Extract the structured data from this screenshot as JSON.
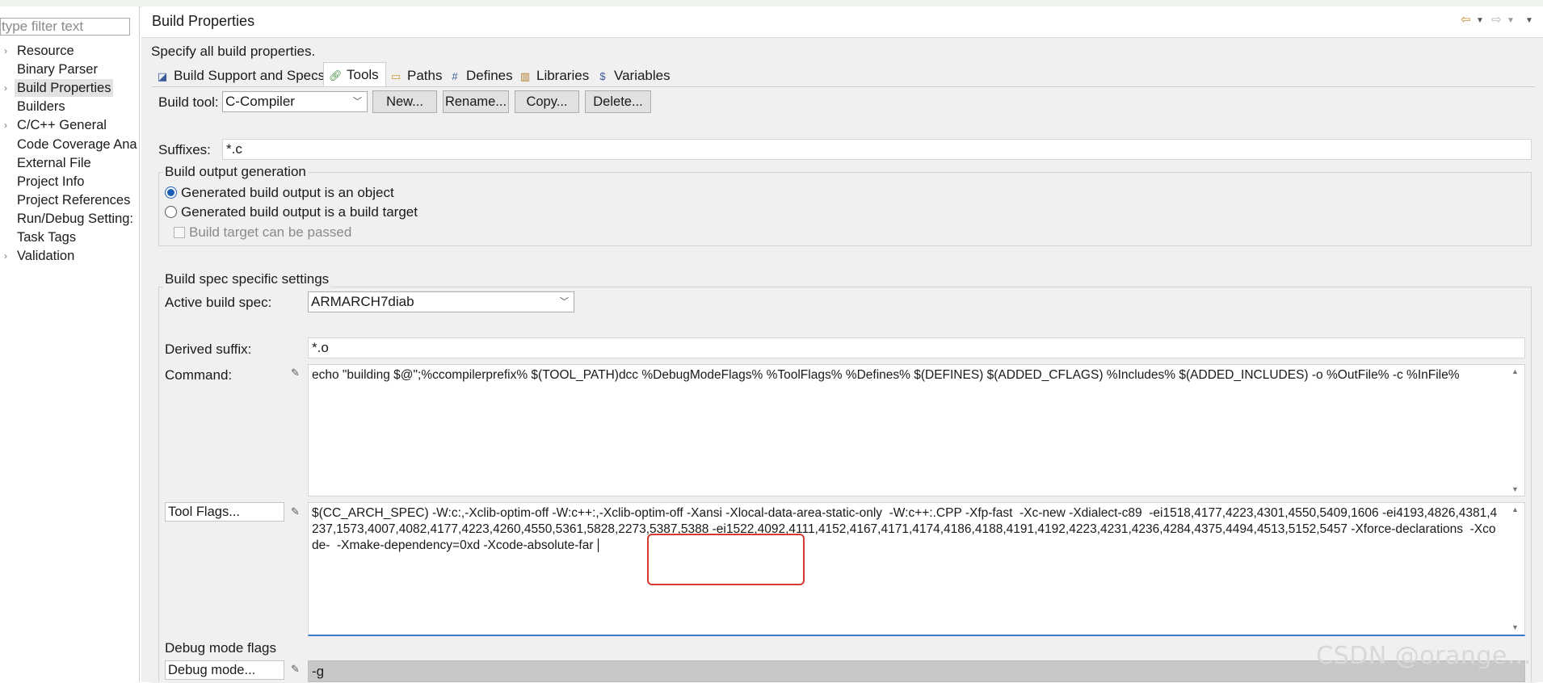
{
  "sidebar": {
    "filter_placeholder": "type filter text",
    "items": [
      {
        "label": "Resource",
        "expandable": true
      },
      {
        "label": "Binary Parser",
        "expandable": false
      },
      {
        "label": "Build Properties",
        "expandable": true,
        "selected": true
      },
      {
        "label": "Builders",
        "expandable": false
      },
      {
        "label": "C/C++ General",
        "expandable": true
      },
      {
        "label": "Code Coverage Ana",
        "expandable": false
      },
      {
        "label": "External File",
        "expandable": false
      },
      {
        "label": "Project Info",
        "expandable": false
      },
      {
        "label": "Project References",
        "expandable": false
      },
      {
        "label": "Run/Debug Setting:",
        "expandable": false
      },
      {
        "label": "Task Tags",
        "expandable": false
      },
      {
        "label": "Validation",
        "expandable": true
      }
    ]
  },
  "header": {
    "title": "Build Properties",
    "subtitle": "Specify all build properties."
  },
  "tabs": [
    {
      "label": "Build Support and Specs",
      "icon": "build-support-icon"
    },
    {
      "label": "Tools",
      "icon": "tools-link-icon",
      "active": true
    },
    {
      "label": "Paths",
      "icon": "folder-icon"
    },
    {
      "label": "Defines",
      "icon": "hash-icon"
    },
    {
      "label": "Libraries",
      "icon": "libraries-icon"
    },
    {
      "label": "Variables",
      "icon": "dollar-icon"
    }
  ],
  "tools": {
    "build_tool_label": "Build tool:",
    "build_tool_value": "C-Compiler",
    "new_btn": "New...",
    "rename_btn": "Rename...",
    "copy_btn": "Copy...",
    "delete_btn": "Delete...",
    "suffixes_label": "Suffixes:",
    "suffixes_value": "*.c"
  },
  "output_group": {
    "title": "Build output generation",
    "radio_object": "Generated build output is an object",
    "radio_target": "Generated build output is a build target",
    "check_passed": "Build target can be passed",
    "selected": "object"
  },
  "spec_group": {
    "title": "Build spec specific settings",
    "active_spec_label": "Active build spec:",
    "active_spec_value": "ARMARCH7diab",
    "derived_suffix_label": "Derived suffix:",
    "derived_suffix_value": "*.o",
    "command_label": "Command:",
    "command_value": "echo \"building $@\";%ccompilerprefix% $(TOOL_PATH)dcc %DebugModeFlags% %ToolFlags% %Defines% $(DEFINES) $(ADDED_CFLAGS) %Includes% $(ADDED_INCLUDES) -o %OutFile% -c %InFile%",
    "tool_flags_btn": "Tool Flags...",
    "tool_flags_value": "$(CC_ARCH_SPEC) -W:c:,-Xclib-optim-off -W:c++:,-Xclib-optim-off -Xansi -Xlocal-data-area-static-only  -W:c++:.CPP -Xfp-fast  -Xc-new -Xdialect-c89  -ei1518,4177,4223,4301,4550,5409,1606 -ei4193,4826,4381,4237,1573,4007,4082,4177,4223,4260,4550,5361,5828,2273,5387,5388 -ei1522,4092,4111,4152,4167,4171,4174,4186,4188,4191,4192,4223,4231,4236,4284,4375,4494,4513,5152,5457 -Xforce-declarations  -Xcode-  -Xmake-dependency=0xd -Xcode-absolute-far ",
    "debug_group_title": "Debug mode flags",
    "debug_mode_btn": "Debug mode...",
    "debug_mode_value": "-g"
  },
  "watermark": "CSDN @orange...",
  "colors": {
    "panel_bg": "#f0f0f0",
    "highlight_box": "#d43a2f",
    "radio_selected": "#1a5fb4",
    "nav_arrow": "#c08a2a"
  }
}
